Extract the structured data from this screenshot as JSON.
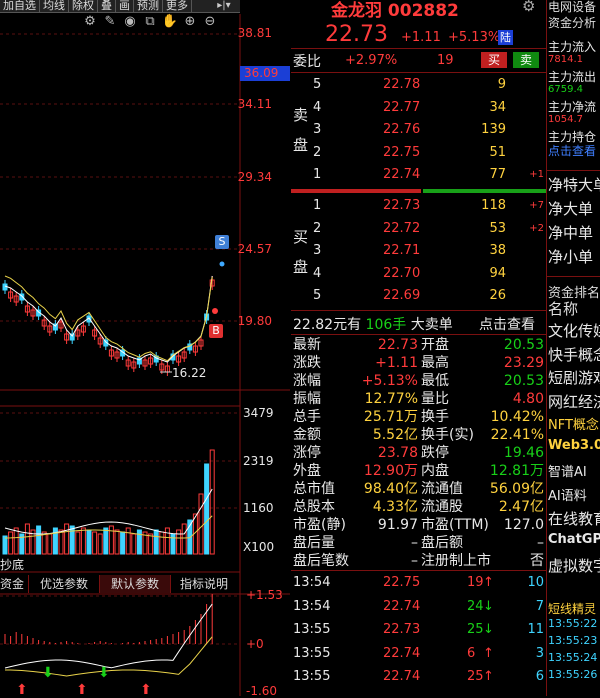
{
  "toolbar": [
    "加自选",
    "均线",
    "除权",
    "叠",
    "画",
    "预测",
    "更多"
  ],
  "price_axis": [
    "38.81",
    "36.09",
    "34.11",
    "29.34",
    "24.57",
    "19.80"
  ],
  "price_marker": "36.09",
  "low_label": "16.22",
  "signal_s": "S",
  "signal_b": "B",
  "vol_axis": [
    "3479",
    "2319",
    "1160",
    "X100"
  ],
  "macd_axis": [
    "+1.53",
    "+0",
    "-1.60"
  ],
  "chart_label_left": "抄底",
  "indicator_tabs": [
    "资金",
    "优选参数",
    "默认参数",
    "指标说明"
  ],
  "quote": {
    "name_code": "金龙羽 002882",
    "price": "22.73",
    "change": "+1.11",
    "pct": "+5.13%",
    "tag": "陆",
    "weibi_label": "委比",
    "weibi_value": "+2.97%",
    "weibi_diff": "19",
    "buy_btn": "买",
    "sell_btn": "卖",
    "sell_label": "卖盘",
    "buy_label": "买盘",
    "sell_levels": [
      {
        "lvl": "5",
        "price": "22.78",
        "vol": "9",
        "delta": ""
      },
      {
        "lvl": "4",
        "price": "22.77",
        "vol": "34",
        "delta": ""
      },
      {
        "lvl": "3",
        "price": "22.76",
        "vol": "139",
        "delta": ""
      },
      {
        "lvl": "2",
        "price": "22.75",
        "vol": "51",
        "delta": ""
      },
      {
        "lvl": "1",
        "price": "22.74",
        "vol": "77",
        "delta": "+1"
      }
    ],
    "buy_levels": [
      {
        "lvl": "1",
        "price": "22.73",
        "vol": "118",
        "delta": "+7"
      },
      {
        "lvl": "2",
        "price": "22.72",
        "vol": "53",
        "delta": "+2"
      },
      {
        "lvl": "3",
        "price": "22.71",
        "vol": "38",
        "delta": ""
      },
      {
        "lvl": "4",
        "price": "22.70",
        "vol": "94",
        "delta": ""
      },
      {
        "lvl": "5",
        "price": "22.69",
        "vol": "26",
        "delta": ""
      }
    ],
    "bigorder": {
      "price": "22.82",
      "unit": "元有",
      "count": "106手",
      "label": "大卖单",
      "link": "点击查看"
    },
    "stats": [
      {
        "l1": "最新",
        "v1": "22.73",
        "l2": "开盘",
        "v2": "20.53"
      },
      {
        "l1": "涨跌",
        "v1": "+1.11",
        "l2": "最高",
        "v2": "23.29"
      },
      {
        "l1": "涨幅",
        "v1": "+5.13%",
        "l2": "最低",
        "v2": "20.53"
      },
      {
        "l1": "振幅",
        "v1": "12.77%",
        "l2": "量比",
        "v2": "4.80"
      },
      {
        "l1": "总手",
        "v1": "25.71万",
        "l2": "换手",
        "v2": "10.42%"
      },
      {
        "l1": "金额",
        "v1": "5.52亿",
        "l2": "换手(实)",
        "v2": "22.41%"
      },
      {
        "l1": "涨停",
        "v1": "23.78",
        "l2": "跌停",
        "v2": "19.46"
      },
      {
        "l1": "外盘",
        "v1": "12.90万",
        "l2": "内盘",
        "v2": "12.81万"
      },
      {
        "l1": "总市值",
        "v1": "98.40亿",
        "l2": "流通值",
        "v2": "56.09亿"
      },
      {
        "l1": "总股本",
        "v1": "4.33亿",
        "l2": "流通股",
        "v2": "2.47亿"
      },
      {
        "l1": "市盈(静)",
        "v1": "91.97",
        "l2": "市盈(TTM)",
        "v2": "127.0"
      },
      {
        "l1": "盘后量",
        "v1": "–",
        "l2": "盘后额",
        "v2": "–"
      },
      {
        "l1": "盘后笔数",
        "v1": "–",
        "l2": "注册制上市",
        "v2": "否"
      }
    ],
    "ticks": [
      {
        "time": "13:54",
        "price": "22.75",
        "vol": "19",
        "dir": "up",
        "n": "10"
      },
      {
        "time": "13:54",
        "price": "22.74",
        "vol": "24",
        "dir": "down",
        "n": "7"
      },
      {
        "time": "13:55",
        "price": "22.73",
        "vol": "25",
        "dir": "down",
        "n": "11"
      },
      {
        "time": "13:55",
        "price": "22.74",
        "vol": "6",
        "dir": "up",
        "n": "3"
      },
      {
        "time": "13:55",
        "price": "22.74",
        "vol": "25",
        "dir": "up",
        "n": "6"
      }
    ]
  },
  "sidebar": {
    "tabs": [
      "电网设备",
      "资金分析"
    ],
    "flows": [
      {
        "label": "主力流入",
        "value": "7814.1"
      },
      {
        "label": "主力流出",
        "value": "6759.4"
      },
      {
        "label": "主力净流",
        "value": "1054.7"
      },
      {
        "label": "主力持仓",
        "value": "点击查看"
      }
    ],
    "net": [
      "净特大单",
      "净大单",
      "净中单",
      "净小单"
    ],
    "rank_title": "资金排名",
    "rank_header": "名称",
    "concepts": [
      "文化传媒",
      "快手概念",
      "短剧游戏",
      "网红经济",
      "NFT概念",
      "Web3.0",
      "智谱AI",
      "AI语料",
      "在线教育",
      "ChatGPT",
      "虚拟数字"
    ],
    "news": [
      {
        "t": "短线精灵",
        "time": ""
      },
      {
        "t": "13:55:22",
        "time": ""
      },
      {
        "t": "13:55:23",
        "time": ""
      },
      {
        "t": "13:55:24",
        "time": ""
      },
      {
        "t": "13:55:26",
        "time": ""
      }
    ]
  },
  "colors": {
    "up": "#ff3b3b",
    "down": "#18d018",
    "accent": "#ffd23f",
    "grid": "#7a1010"
  }
}
